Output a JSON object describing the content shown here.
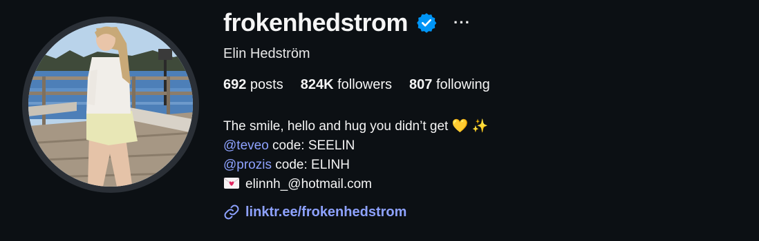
{
  "profile": {
    "username": "frokenhedstrom",
    "full_name": "Elin Hedström",
    "more_label": "···",
    "verified_icon": "verified-badge-icon",
    "avatar_icon": "profile-photo"
  },
  "stats": {
    "posts": {
      "count": "692",
      "label": " posts"
    },
    "followers": {
      "count": "824K",
      "label": " followers"
    },
    "following": {
      "count": "807",
      "label": " following"
    }
  },
  "bio": {
    "line1_text": "The smile, hello and hug you didn’t get ",
    "line1_emoji1": "💛",
    "line1_emoji2": "✨",
    "line2_mention": "@teveo",
    "line2_text": " code: SEELIN",
    "line3_mention": "@prozis",
    "line3_text": " code: ELINH",
    "line4_icon": "love-letter-icon",
    "line4_text": "elinnh_@hotmail.com"
  },
  "link": {
    "icon": "link-icon",
    "text": "linktr.ee/frokenhedstrom"
  },
  "colors": {
    "background": "#0c1014",
    "text": "#f5f5f5",
    "link": "#8ea2ff",
    "verified": "#0095f6"
  }
}
